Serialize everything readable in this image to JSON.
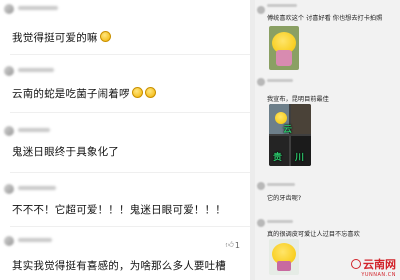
{
  "left_comments": [
    {
      "text": "我觉得挺可爱的嘛",
      "emoji": "smile-emoji",
      "likes": ""
    },
    {
      "text": "云南的蛇是吃菌子闹着啰",
      "emoji": "laugh-cry-emoji",
      "likes": ""
    },
    {
      "text": "鬼迷日眼终于具象化了",
      "emoji": "",
      "likes": ""
    },
    {
      "text": "不不不！它超可爱！！！鬼迷日眼可爱！！！",
      "emoji": "",
      "likes": ""
    },
    {
      "text": "其实我觉得挺有喜感的，为啥那么多人要吐槽",
      "emoji": "",
      "likes": "1"
    }
  ],
  "right_comments": [
    {
      "text": "傅统喜欢这个 讨喜好看 你也想去打卡拍照",
      "likes": ""
    },
    {
      "text": "",
      "likes": ""
    },
    {
      "text": "我宣布，昆明目前最佳",
      "likes": ""
    },
    {
      "text": "它的牙齿呢?",
      "likes": ""
    },
    {
      "text": "真的很调皮可爱让人过目不忘喜欢",
      "likes": ""
    }
  ],
  "stickers": {
    "label_top": "云",
    "label_bottom_left": "贵",
    "label_bottom_right": "川"
  },
  "watermark": {
    "name": "云南网",
    "url": "YUNNAN.CN"
  }
}
